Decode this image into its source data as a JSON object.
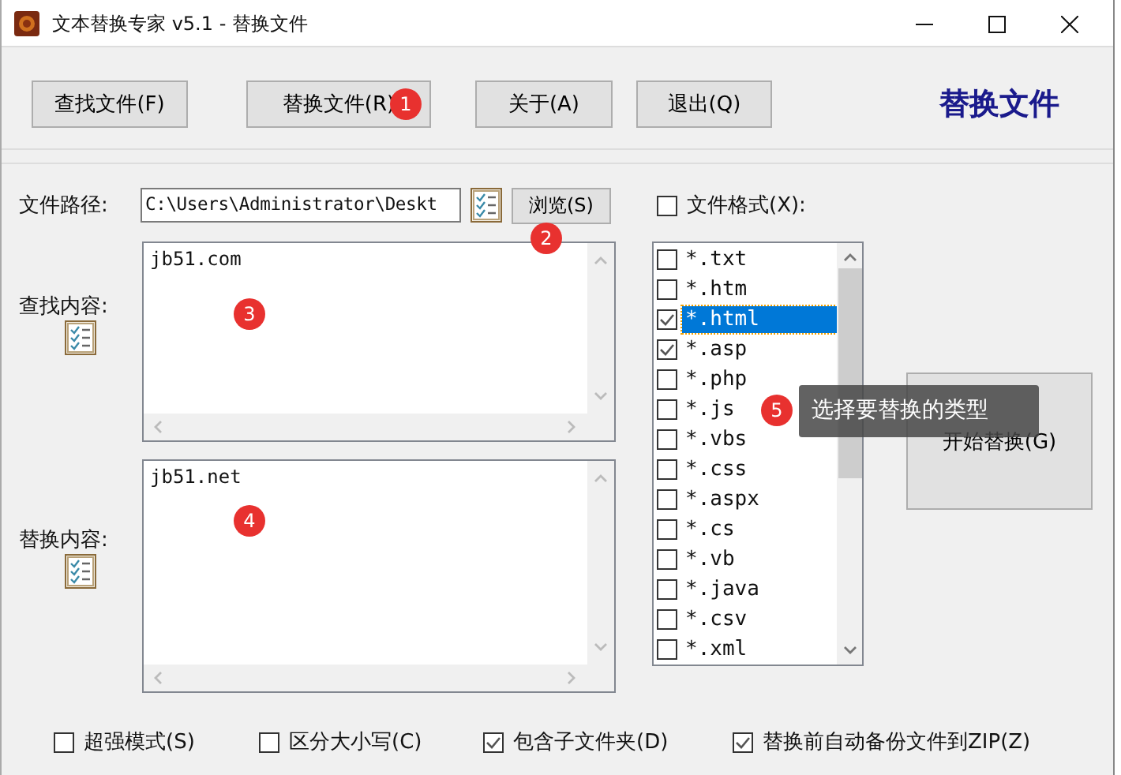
{
  "window": {
    "title": "文本替换专家 v5.1  -  替换文件"
  },
  "toolbar": {
    "buttons": [
      {
        "label": "查找文件(F)"
      },
      {
        "label": "替换文件(R)",
        "badge": "1"
      },
      {
        "label": "关于(A)"
      },
      {
        "label": "退出(Q)"
      }
    ],
    "heading": "替换文件"
  },
  "path": {
    "label": "文件路径:",
    "value": "C:\\Users\\Administrator\\Deskt",
    "browse": "浏览(S)",
    "badge": "2"
  },
  "find": {
    "label": "查找内容:",
    "value": "jb51.com",
    "badge": "3"
  },
  "replace": {
    "label": "替换内容:",
    "value": "jb51.net",
    "badge": "4"
  },
  "file_format": {
    "label": "文件格式(X):",
    "checked": false
  },
  "file_types": [
    {
      "label": "*.txt",
      "checked": false,
      "selected": false
    },
    {
      "label": "*.htm",
      "checked": false,
      "selected": false
    },
    {
      "label": "*.html",
      "checked": true,
      "selected": true
    },
    {
      "label": "*.asp",
      "checked": true,
      "selected": false
    },
    {
      "label": "*.php",
      "checked": false,
      "selected": false
    },
    {
      "label": "*.js",
      "checked": false,
      "selected": false
    },
    {
      "label": "*.vbs",
      "checked": false,
      "selected": false
    },
    {
      "label": "*.css",
      "checked": false,
      "selected": false
    },
    {
      "label": "*.aspx",
      "checked": false,
      "selected": false
    },
    {
      "label": "*.cs",
      "checked": false,
      "selected": false
    },
    {
      "label": "*.vb",
      "checked": false,
      "selected": false
    },
    {
      "label": "*.java",
      "checked": false,
      "selected": false
    },
    {
      "label": "*.csv",
      "checked": false,
      "selected": false
    },
    {
      "label": "*.xml",
      "checked": false,
      "selected": false
    }
  ],
  "tooltip": {
    "text": "选择要替换的类型",
    "badge": "5"
  },
  "start_button": "开始替换(G)",
  "options": [
    {
      "label": "超强模式(S)",
      "checked": false
    },
    {
      "label": "区分大小写(C)",
      "checked": false
    },
    {
      "label": "包含子文件夹(D)",
      "checked": true
    },
    {
      "label": "替换前自动备份文件到ZIP(Z)",
      "checked": true
    }
  ]
}
